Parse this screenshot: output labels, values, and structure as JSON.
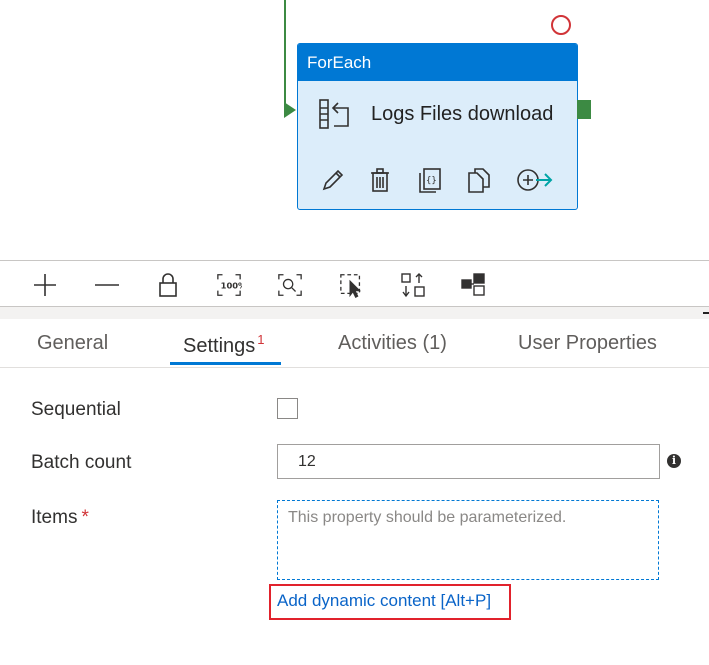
{
  "activity": {
    "type_label": "ForEach",
    "name": "Logs Files download",
    "icon": "foreach-icon",
    "actions": [
      "edit-icon",
      "delete-icon",
      "code-icon",
      "copy-icon",
      "add-output-icon"
    ]
  },
  "toolbar": {
    "tools": [
      "zoom-in-icon",
      "zoom-out-icon",
      "lock-icon",
      "zoom-100-icon",
      "zoom-to-fit-icon",
      "select-icon",
      "auto-align-icon",
      "arrange-icon"
    ],
    "zoom_100_text": "100%"
  },
  "tabs": [
    {
      "label": "General",
      "badge": ""
    },
    {
      "label": "Settings",
      "badge": "1"
    },
    {
      "label": "Activities (1)",
      "badge": ""
    },
    {
      "label": "User Properties",
      "badge": ""
    }
  ],
  "settings": {
    "sequential_label": "Sequential",
    "sequential_checked": false,
    "batch_count_label": "Batch count",
    "batch_count_value": "12",
    "info_glyph": "i",
    "items_label": "Items",
    "items_required": "*",
    "items_placeholder": "This property should be parameterized.",
    "dynamic_content_link": "Add dynamic content [Alt+P]"
  },
  "colors": {
    "accent": "#0078d4",
    "success_connector": "#3c8a43",
    "error": "#d13438",
    "highlight": "#e1222c"
  }
}
